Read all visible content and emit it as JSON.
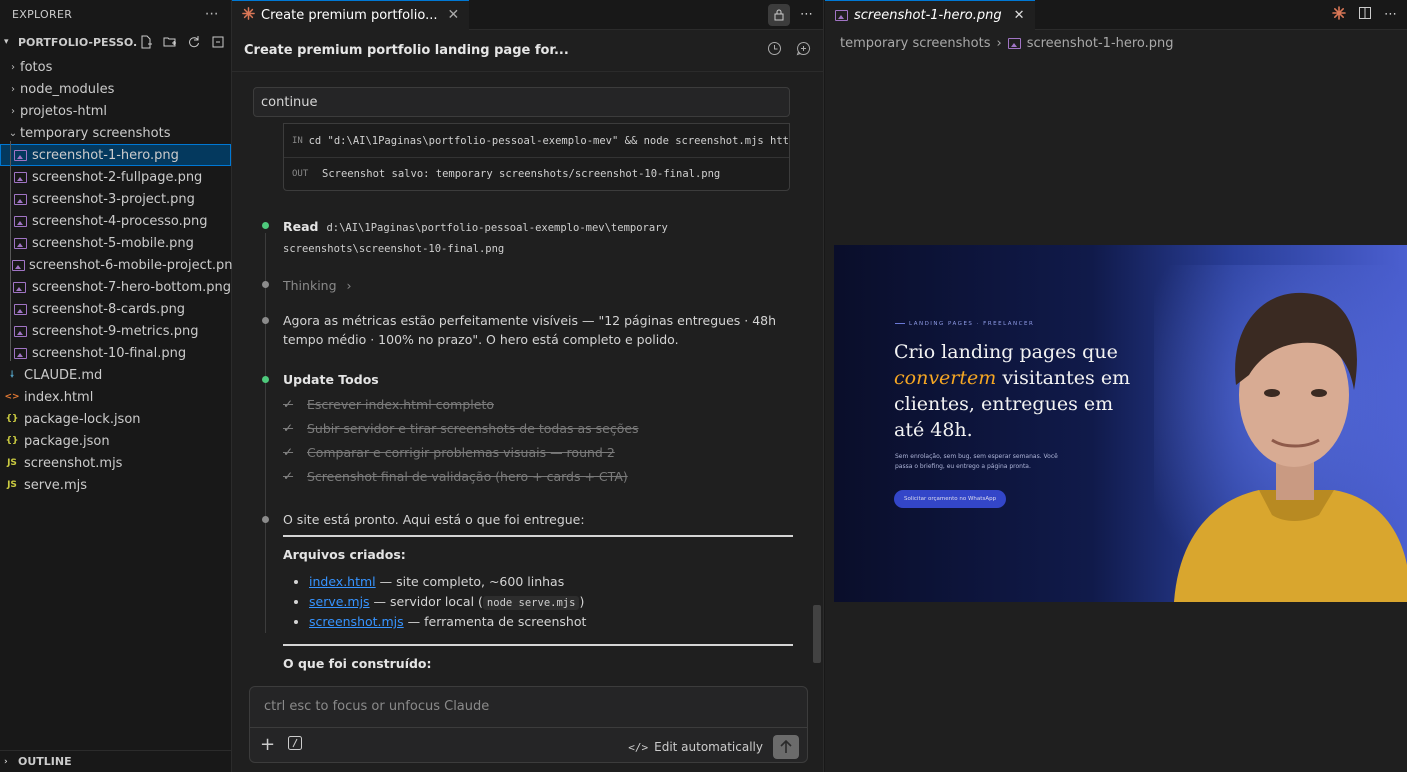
{
  "explorer": {
    "title": "EXPLORER",
    "project": "PORTFOLIO-PESSO...",
    "items": [
      {
        "label": "fotos",
        "type": "folder",
        "depth": 0,
        "open": false
      },
      {
        "label": "node_modules",
        "type": "folder",
        "depth": 0,
        "open": false
      },
      {
        "label": "projetos-html",
        "type": "folder",
        "depth": 0,
        "open": false
      },
      {
        "label": "temporary screenshots",
        "type": "folder",
        "depth": 0,
        "open": true
      },
      {
        "label": "screenshot-1-hero.png",
        "type": "png",
        "depth": 1,
        "selected": true
      },
      {
        "label": "screenshot-2-fullpage.png",
        "type": "png",
        "depth": 1
      },
      {
        "label": "screenshot-3-project.png",
        "type": "png",
        "depth": 1
      },
      {
        "label": "screenshot-4-processo.png",
        "type": "png",
        "depth": 1
      },
      {
        "label": "screenshot-5-mobile.png",
        "type": "png",
        "depth": 1
      },
      {
        "label": "screenshot-6-mobile-project.png",
        "type": "png",
        "depth": 1
      },
      {
        "label": "screenshot-7-hero-bottom.png",
        "type": "png",
        "depth": 1
      },
      {
        "label": "screenshot-8-cards.png",
        "type": "png",
        "depth": 1
      },
      {
        "label": "screenshot-9-metrics.png",
        "type": "png",
        "depth": 1
      },
      {
        "label": "screenshot-10-final.png",
        "type": "png",
        "depth": 1
      },
      {
        "label": "CLAUDE.md",
        "type": "md",
        "depth": 0
      },
      {
        "label": "index.html",
        "type": "html",
        "depth": 0
      },
      {
        "label": "package-lock.json",
        "type": "json",
        "depth": 0
      },
      {
        "label": "package.json",
        "type": "json",
        "depth": 0
      },
      {
        "label": "screenshot.mjs",
        "type": "js",
        "depth": 0
      },
      {
        "label": "serve.mjs",
        "type": "js",
        "depth": 0
      }
    ],
    "outline": "OUTLINE"
  },
  "chat": {
    "tab_title": "Create premium portfolio...",
    "title": "Create premium portfolio landing page for...",
    "continue_text": "continue",
    "io_in_tag": "IN",
    "io_in": "cd \"d:\\AI\\1Paginas\\portfolio-pessoal-exemplo-mev\" && node screenshot.mjs htt",
    "io_out_tag": "OUT",
    "io_out": "Screenshot salvo: temporary screenshots/screenshot-10-final.png",
    "read_label": "Read",
    "read_path": "d:\\AI\\1Paginas\\portfolio-pessoal-exemplo-mev\\temporary screenshots\\screenshot-10-final.png",
    "thinking": "Thinking",
    "metrics_text": "Agora as métricas estão perfeitamente visíveis — \"12 páginas entregues · 48h tempo médio · 100% no prazo\". O hero está completo e polido.",
    "update_todos": "Update Todos",
    "todos": [
      "Escrever index.html completo",
      "Subir servidor e tirar screenshots de todas as seções",
      "Comparar e corrigir problemas visuais — round 2",
      "Screenshot final de validação (hero + cards + CTA)"
    ],
    "ready_text": "O site está pronto. Aqui está o que foi entregue:",
    "files_heading": "Arquivos criados:",
    "files": [
      {
        "name": "index.html",
        "desc": " — site completo, ~600 linhas"
      },
      {
        "name": "serve.mjs",
        "desc": " — servidor local (",
        "code": "node serve.mjs",
        "tail": ")"
      },
      {
        "name": "screenshot.mjs",
        "desc": " — ferramenta de screenshot"
      }
    ],
    "built_heading": "O que foi construído:",
    "input_placeholder": "ctrl esc to focus or unfocus Claude",
    "edit_mode": "Edit automatically"
  },
  "preview": {
    "tab_title": "screenshot-1-hero.png",
    "crumb_folder": "temporary screenshots",
    "crumb_file": "screenshot-1-hero.png",
    "hero": {
      "eyebrow": "LANDING PAGES · FREELANCER",
      "line1": "Crio landing pages que",
      "highlight": "convertem",
      "line2_rest": " visitantes em",
      "line3": "clientes, entregues em",
      "line4": "até 48h.",
      "sub": "Sem enrolação, sem bug, sem esperar semanas. Você passa o briefing, eu entrego a página pronta.",
      "cta": "Solicitar orçamento no WhatsApp"
    }
  },
  "colors": {
    "accent": "#0078d4",
    "selection": "#04395e",
    "link": "#3794ff",
    "hero_highlight": "#f5a623",
    "claude_orange": "#d97757"
  }
}
